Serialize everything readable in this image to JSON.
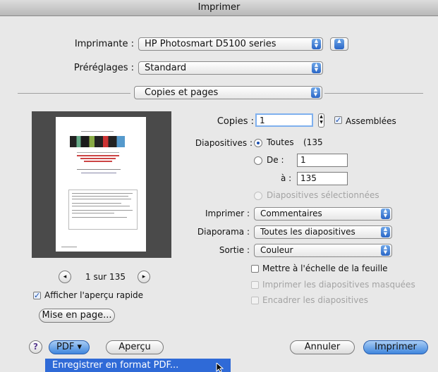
{
  "window": {
    "title": "Imprimer"
  },
  "printer": {
    "label": "Imprimante :",
    "value": "HP Photosmart D5100 series"
  },
  "presets": {
    "label": "Préréglages :",
    "value": "Standard"
  },
  "section": {
    "value": "Copies et pages"
  },
  "copies": {
    "label": "Copies :",
    "value": "1",
    "collated_label": "Assemblées"
  },
  "slides": {
    "label": "Diapositives :",
    "all_label": "Toutes",
    "all_count": "(135",
    "from_label": "De :",
    "from_value": "1",
    "to_label": "à :",
    "to_value": "135",
    "selected_label": "Diapositives sélectionnées"
  },
  "print_what": {
    "label": "Imprimer :",
    "value": "Commentaires"
  },
  "slideshow": {
    "label": "Diaporama :",
    "value": "Toutes les diapositives"
  },
  "output": {
    "label": "Sortie :",
    "value": "Couleur"
  },
  "options": {
    "scale": "Mettre à l'échelle de la feuille",
    "hidden": "Imprimer les diapositives masquées",
    "frame": "Encadrer les diapositives"
  },
  "preview_nav": {
    "page_text": "1 sur 135"
  },
  "quick_preview": {
    "label": "Afficher l'aperçu rapide"
  },
  "buttons": {
    "page_setup": "Mise en page...",
    "help": "?",
    "pdf": "PDF ▾",
    "preview": "Aperçu",
    "cancel": "Annuler",
    "print": "Imprimer"
  },
  "pdf_menu": {
    "item_save": "Enregistrer en format PDF..."
  }
}
